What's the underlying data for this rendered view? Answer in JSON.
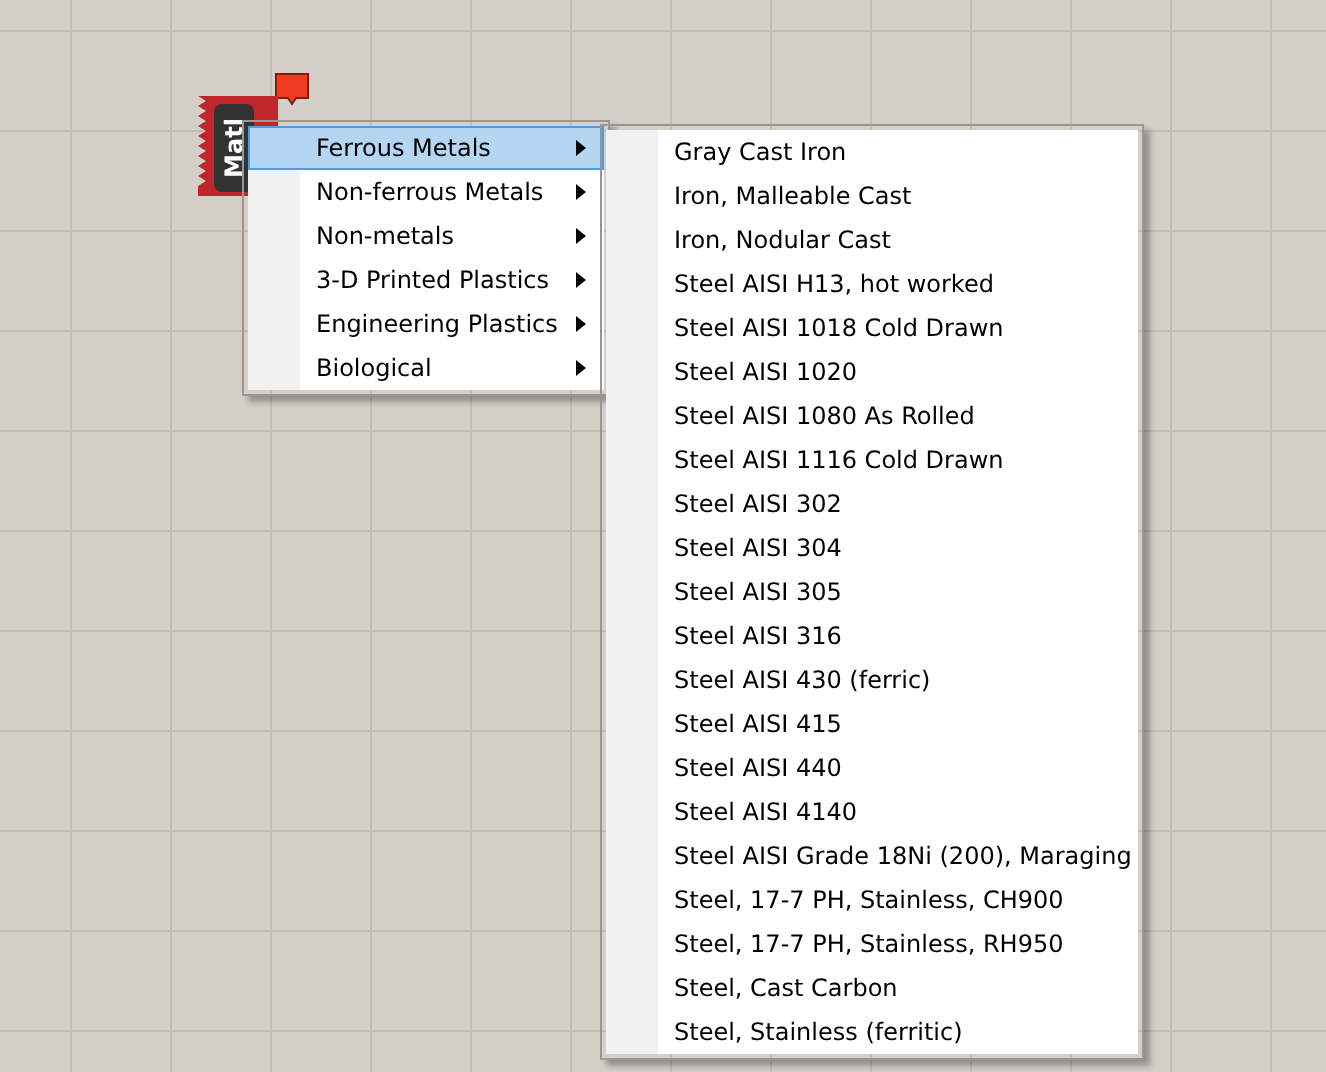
{
  "component": {
    "label": "Matl"
  },
  "menu": [
    {
      "label": "Ferrous Metals",
      "selected": true
    },
    {
      "label": "Non-ferrous Metals",
      "selected": false
    },
    {
      "label": "Non-metals",
      "selected": false
    },
    {
      "label": "3-D Printed Plastics",
      "selected": false
    },
    {
      "label": "Engineering Plastics",
      "selected": false
    },
    {
      "label": "Biological",
      "selected": false
    }
  ],
  "submenu": [
    "Gray Cast Iron",
    "Iron, Malleable Cast",
    "Iron, Nodular Cast",
    "Steel AISI H13, hot worked",
    "Steel AISI 1018 Cold Drawn",
    "Steel AISI 1020",
    "Steel AISI 1080 As Rolled",
    "Steel AISI 1116 Cold Drawn",
    "Steel AISI 302",
    "Steel AISI 304",
    "Steel AISI 305",
    "Steel AISI 316",
    "Steel AISI 430 (ferric)",
    "Steel AISI 415",
    "Steel AISI 440",
    "Steel AISI 4140",
    "Steel AISI Grade 18Ni (200), Maraging",
    "Steel, 17-7 PH, Stainless, CH900",
    "Steel, 17-7 PH, Stainless, RH950",
    "Steel, Cast Carbon",
    "Steel, Stainless (ferritic)"
  ]
}
